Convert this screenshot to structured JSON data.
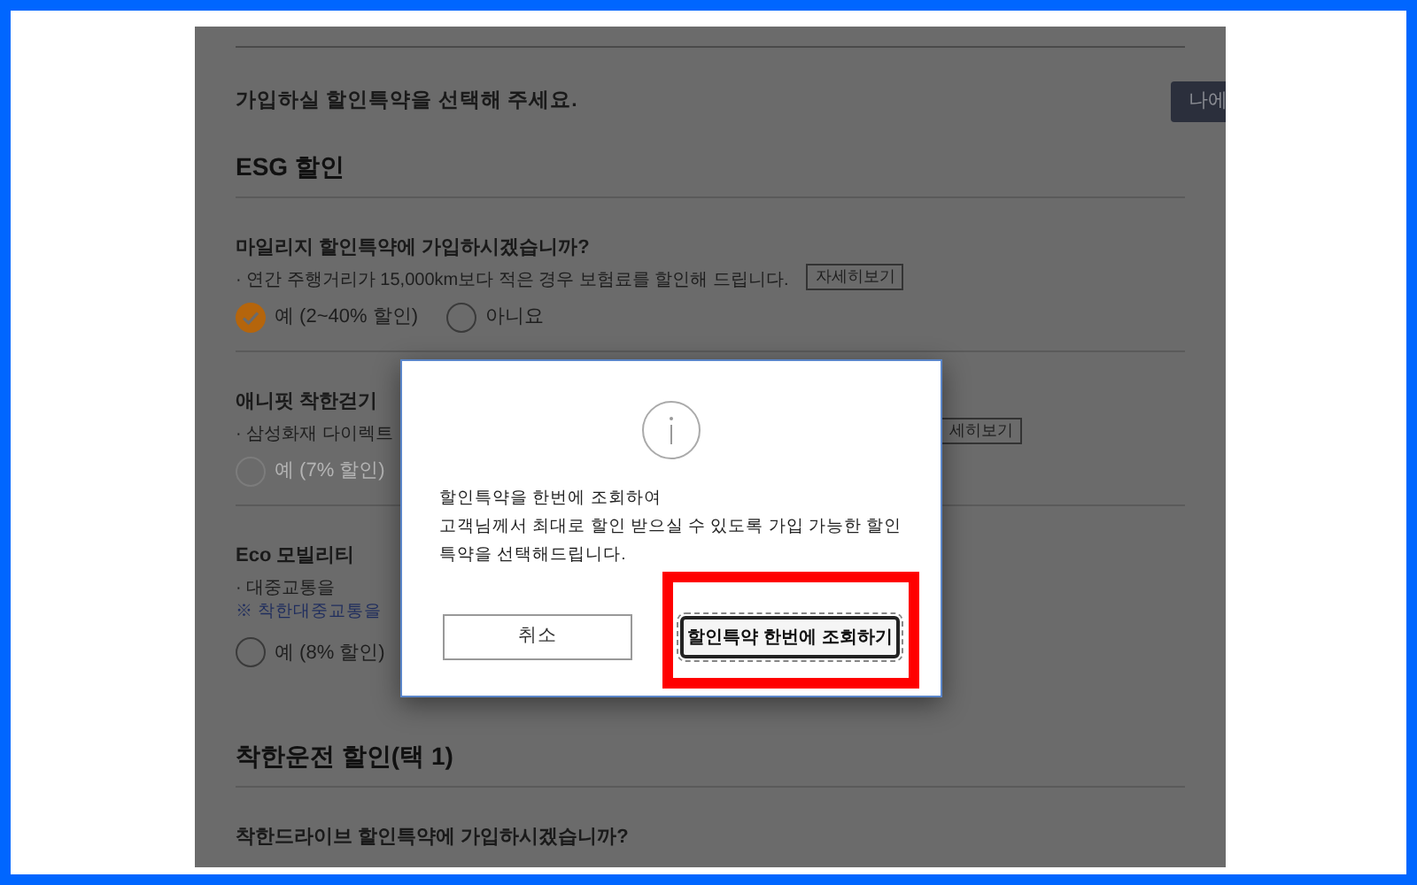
{
  "page": {
    "intro": "가입하실 할인특약을 선택해 주세요.",
    "top_button": "나에",
    "sections": [
      {
        "title": "ESG 할인",
        "items": [
          {
            "question": "마일리지 할인특약에 가입하시겠습니까?",
            "description": "· 연간 주행거리가 15,000km보다 적은 경우 보험료를 할인해 드립니다.",
            "detail_button": "자세히보기",
            "kind": "inline",
            "disabled": false,
            "options": [
              {
                "label": "예 (2~40% 할인)",
                "selected": true
              },
              {
                "label": "아니요",
                "selected": false
              }
            ]
          },
          {
            "question": "애니핏 착한걷기",
            "description": "· 삼성화재 다이렉트",
            "detail_button": "세히보기",
            "kind": "covered",
            "disabled": true,
            "options": [
              {
                "label": "예 (7% 할인)",
                "selected": false
              }
            ]
          },
          {
            "question": "Eco 모빌리티",
            "description": "· 대중교통을",
            "note": "※ 착한대중교통을",
            "kind": "covered",
            "disabled": false,
            "options": [
              {
                "label": "예 (8% 할인)",
                "selected": false
              }
            ]
          }
        ]
      },
      {
        "title": "착한운전 할인(택 1)",
        "items": [
          {
            "question": "착한드라이브 할인특약에 가입하시겠습니까?"
          }
        ]
      }
    ]
  },
  "dialog": {
    "message": "할인특약을 한번에 조회하여\n고객님께서 최대로 할인 받으실 수 있도록 가입 가능한 할인\n특약을 선택해드립니다.",
    "cancel_button": "취소",
    "confirm_button": "할인특약 한번에 조회하기",
    "confirm_highlighted": true
  }
}
